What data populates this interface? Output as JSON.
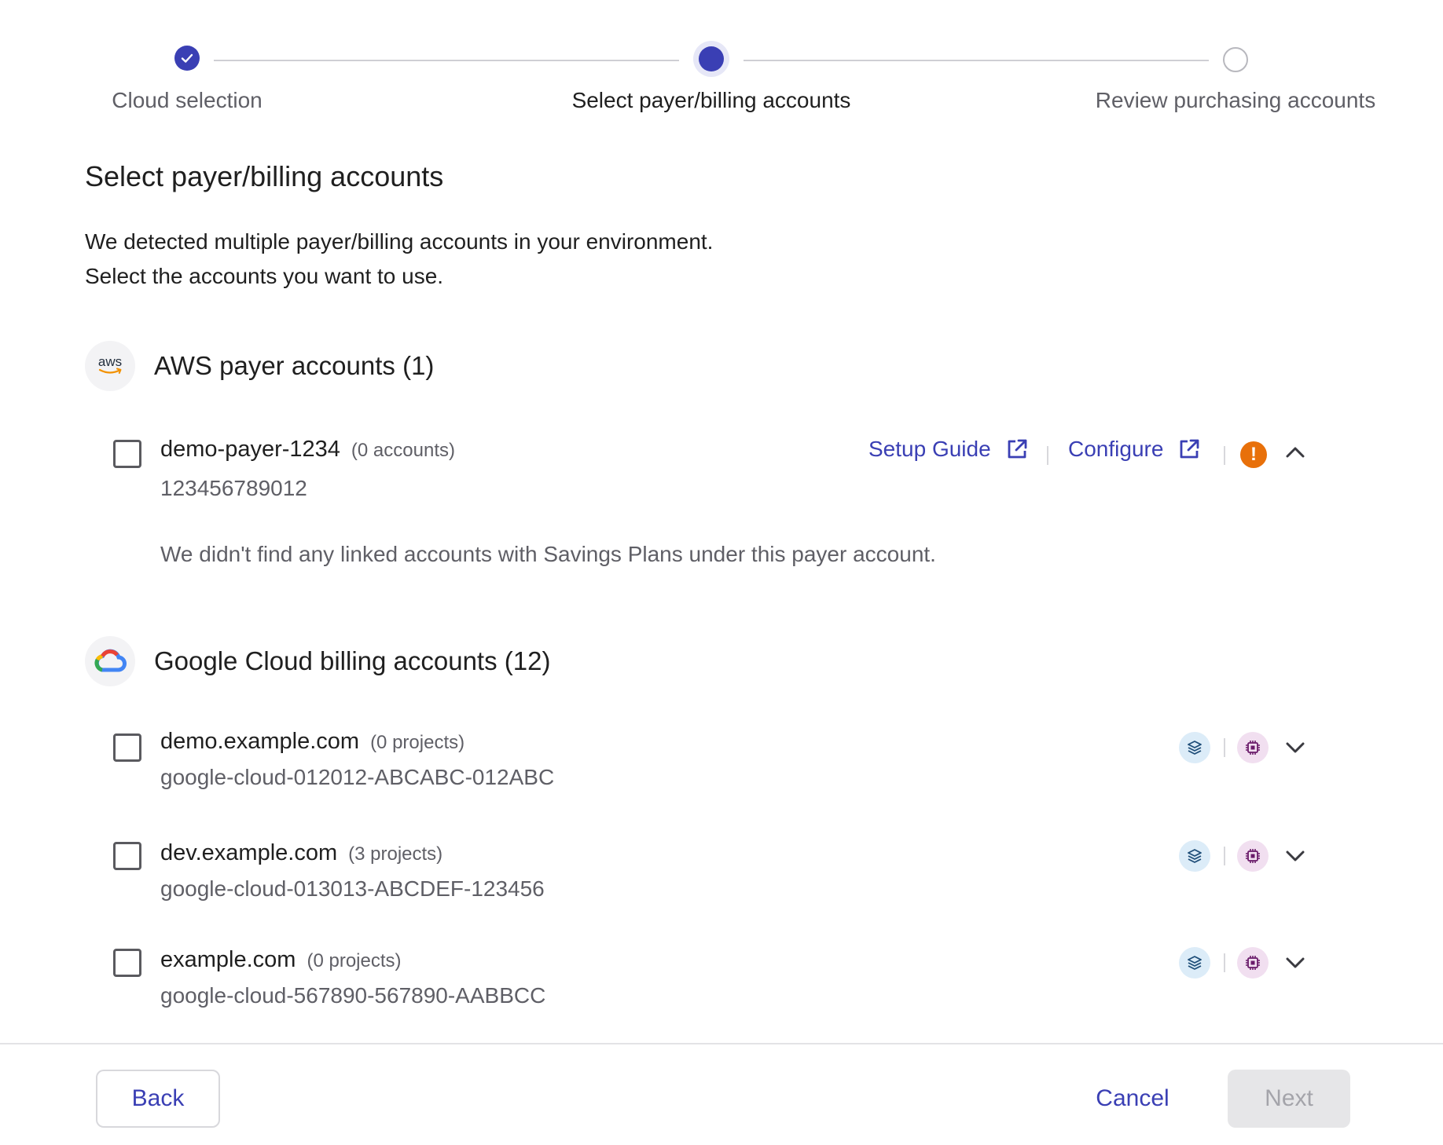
{
  "stepper": {
    "steps": [
      {
        "label": "Cloud selection",
        "state": "done"
      },
      {
        "label": "Select payer/billing accounts",
        "state": "active"
      },
      {
        "label": "Review purchasing accounts",
        "state": "todo"
      }
    ]
  },
  "page": {
    "title": "Select payer/billing accounts",
    "intro_line1": "We detected multiple payer/billing accounts in your environment.",
    "intro_line2": "Select the accounts you want to use."
  },
  "aws": {
    "logo_text": "aws",
    "title": "AWS payer accounts (1)",
    "accounts": [
      {
        "name": "demo-payer-1234",
        "count": "(0 accounts)",
        "id": "123456789012",
        "setup_guide": "Setup Guide",
        "configure": "Configure",
        "note": "We didn't find any linked accounts with Savings Plans under this payer account."
      }
    ]
  },
  "gcp": {
    "title": "Google Cloud billing accounts (12)",
    "accounts": [
      {
        "name": "demo.example.com",
        "count": "(0 projects)",
        "id": "google-cloud-012012-ABCABC-012ABC"
      },
      {
        "name": "dev.example.com",
        "count": "(3 projects)",
        "id": "google-cloud-013013-ABCDEF-123456"
      },
      {
        "name": "example.com",
        "count": "(0 projects)",
        "id": "google-cloud-567890-567890-AABBCC"
      }
    ]
  },
  "footer": {
    "back": "Back",
    "cancel": "Cancel",
    "next": "Next"
  },
  "colors": {
    "accent": "#3a3fb4",
    "warning": "#e8700a",
    "muted_text": "#5f5f66",
    "disabled_bg": "#e6e6e8"
  },
  "icons": {
    "step_done": "check-icon",
    "external_link": "external-link-icon",
    "warning": "warning-icon",
    "expand_up": "chevron-up-icon",
    "expand_down": "chevron-down-icon",
    "layers": "layers-icon",
    "chip": "chip-icon"
  }
}
